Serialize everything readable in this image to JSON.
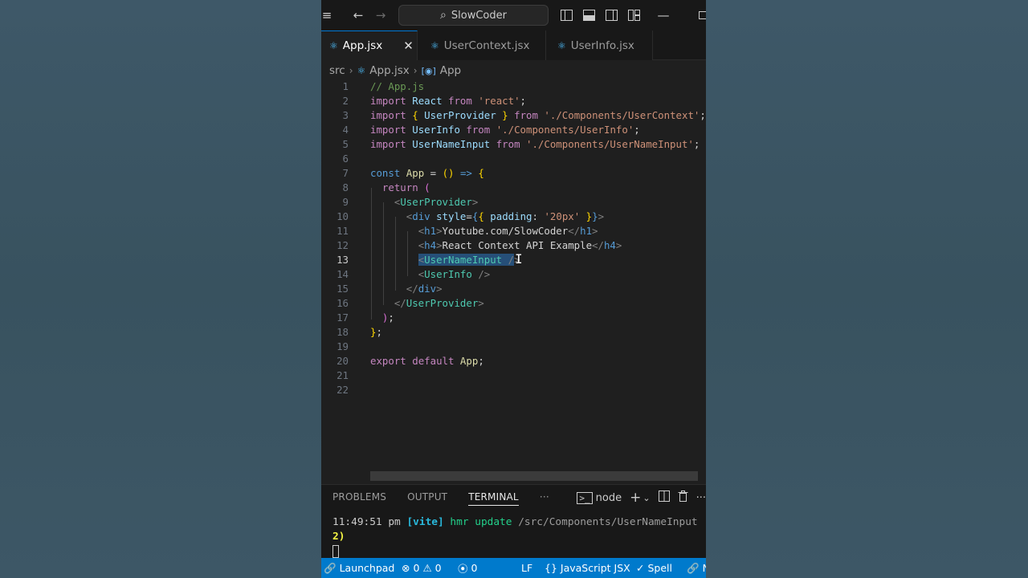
{
  "titlebar": {
    "menu_icon": "hamburger-icon",
    "search_text": "SlowCoder"
  },
  "tabs": [
    {
      "label": "App.jsx",
      "active": true
    },
    {
      "label": "UserContext.jsx",
      "active": false
    },
    {
      "label": "UserInfo.jsx",
      "active": false
    }
  ],
  "breadcrumb": {
    "folder": "src",
    "file": "App.jsx",
    "symbol": "App"
  },
  "editor": {
    "line_numbers": [
      "1",
      "2",
      "3",
      "4",
      "5",
      "6",
      "7",
      "8",
      "9",
      "10",
      "11",
      "12",
      "13",
      "14",
      "15",
      "16",
      "17",
      "18",
      "19",
      "20",
      "21",
      "22"
    ],
    "current_line": 13,
    "lines": [
      "// App.js",
      "import React from 'react';",
      "import { UserProvider } from './Components/UserContext';",
      "import UserInfo from './Components/UserInfo';",
      "import UserNameInput from './Components/UserNameInput';",
      "",
      "const App = () => {",
      "  return (",
      "    <UserProvider>",
      "      <div style={{ padding: '20px' }}>",
      "        <h1>Youtube.com/SlowCoder</h1>",
      "        <h4>React Context API Example</h4>",
      "        <UserNameInput />",
      "        <UserInfo />",
      "      </div>",
      "    </UserProvider>",
      "  );",
      "};",
      "",
      "export default App;",
      "",
      ""
    ]
  },
  "panel": {
    "tabs": [
      "PROBLEMS",
      "OUTPUT",
      "TERMINAL"
    ],
    "more": "···",
    "terminal_name": "node",
    "terminal": {
      "time": "11:49:51 pm",
      "tag": "[vite]",
      "action": "hmr update",
      "path": "/src/Components/UserNameInput",
      "count": "2)"
    }
  },
  "statusbar": {
    "launchpad": "Launchpad",
    "errors": "0",
    "warnings": "0",
    "ports": "0",
    "eol": "LF",
    "language": "JavaScript JSX",
    "spell": "Spell",
    "last": "N"
  },
  "colors": {
    "accent": "#007acc",
    "editor_bg": "#1f1f1f",
    "selection": "#264f78"
  }
}
